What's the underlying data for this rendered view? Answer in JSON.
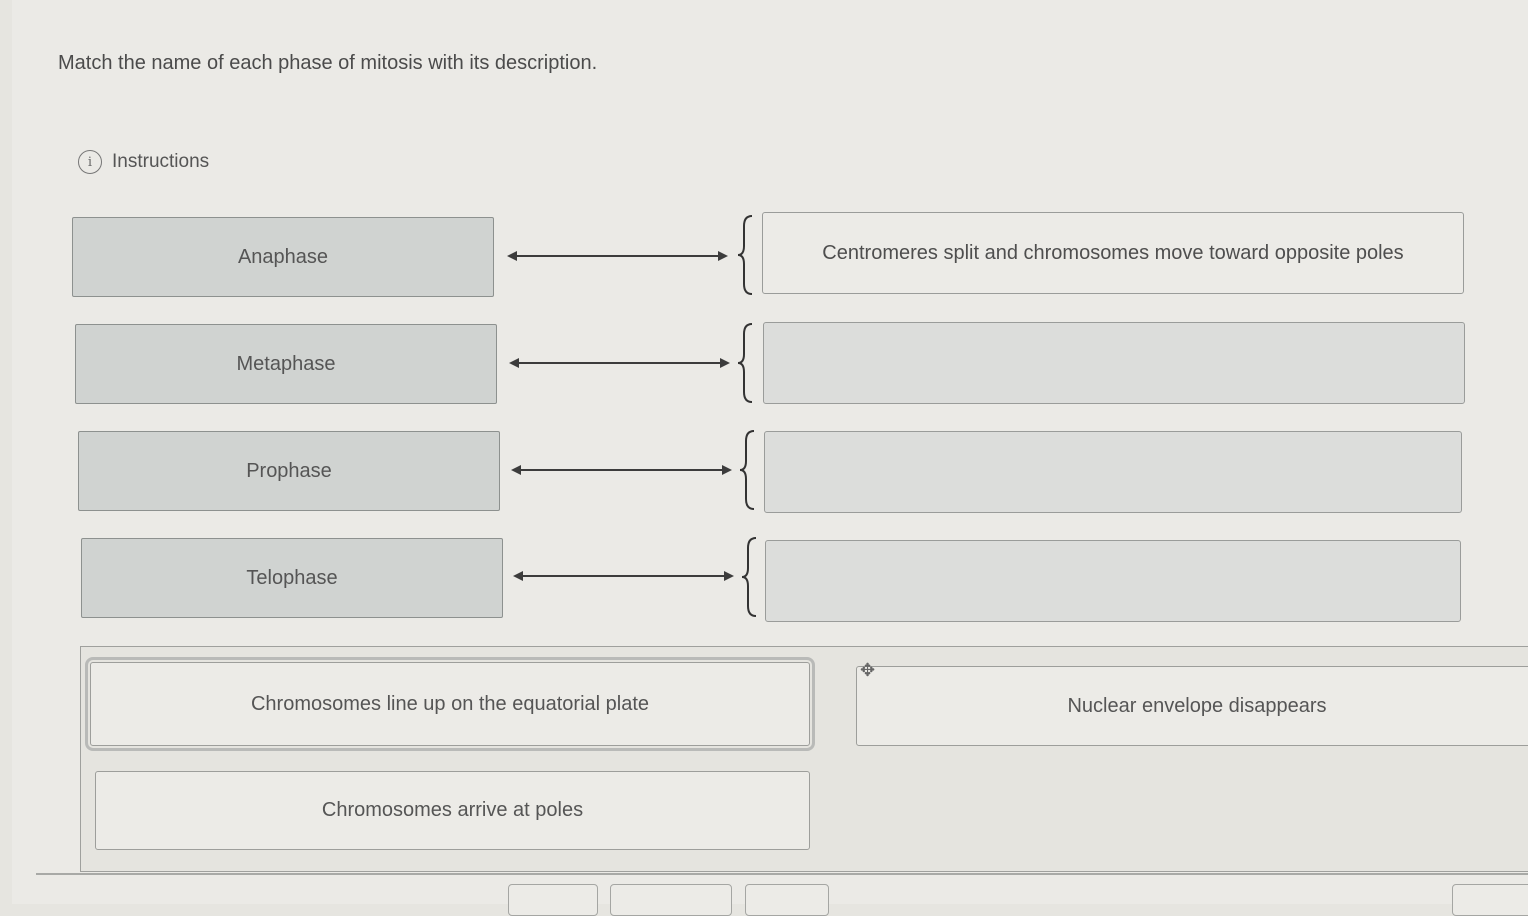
{
  "question": {
    "text": "Match the name of each phase of mitosis with its description."
  },
  "instructions": {
    "label": "Instructions",
    "icon": "info-icon"
  },
  "terms": [
    {
      "label": "Anaphase"
    },
    {
      "label": "Metaphase"
    },
    {
      "label": "Prophase"
    },
    {
      "label": "Telophase"
    }
  ],
  "targets": [
    {
      "value": "Centromeres split and chromosomes move toward opposite poles"
    },
    {
      "value": ""
    },
    {
      "value": ""
    },
    {
      "value": ""
    }
  ],
  "choices": [
    {
      "label": "Chromosomes line up on the equatorial plate"
    },
    {
      "label": "Nuclear envelope disappears"
    },
    {
      "label": "Chromosomes arrive at poles"
    }
  ],
  "move_icon": "move-icon"
}
